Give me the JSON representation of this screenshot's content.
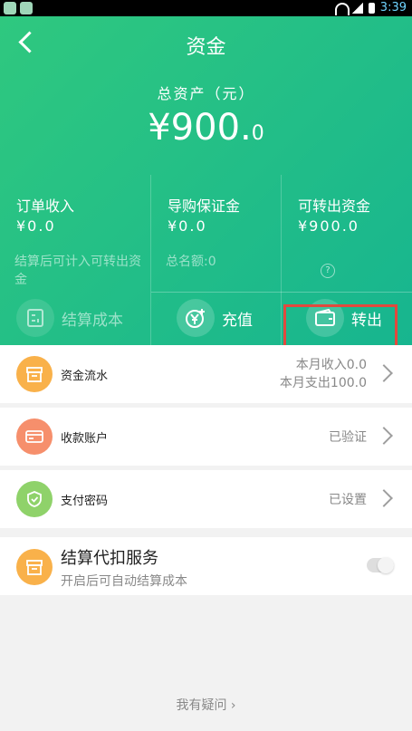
{
  "status_bar": {
    "time": "3:39"
  },
  "header": {
    "title": "资金",
    "total_label": "总资产（元）",
    "total_int": "¥900.",
    "total_dec": "0"
  },
  "cards": [
    {
      "label": "订单收入",
      "value": "¥0.0",
      "note": "结算后可计入可转出资金"
    },
    {
      "label": "导购保证金",
      "value": "¥0.0",
      "note": "总名额:0"
    },
    {
      "label": "可转出资金",
      "value": "¥900.0",
      "note": "?"
    }
  ],
  "actions": {
    "settle": "结算成本",
    "recharge": "充值",
    "withdraw": "转出"
  },
  "list": [
    {
      "label": "资金流水",
      "right_line1": "本月收入0.0",
      "right_line2": "本月支出100.0"
    },
    {
      "label": "收款账户",
      "right": "已验证"
    },
    {
      "label": "支付密码",
      "right": "已设置"
    }
  ],
  "service": {
    "title": "结算代扣服务",
    "subtitle": "开启后可自动结算成本"
  },
  "help_link": "我有疑问 ›",
  "colors": {
    "primary_green": "#2fc87f",
    "highlight_red": "#e2493d",
    "icon_orange": "#f9b14a",
    "icon_salmon": "#f68f6c",
    "icon_green": "#8fd26a"
  }
}
